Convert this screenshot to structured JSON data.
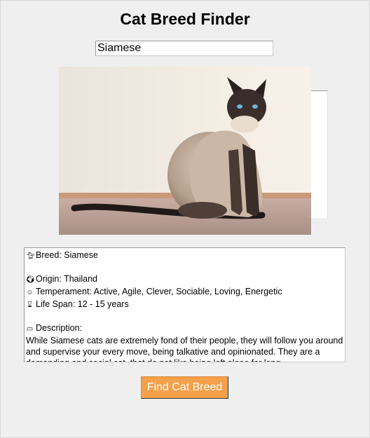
{
  "app": {
    "title": "Cat Breed Finder"
  },
  "search": {
    "value": "Siamese"
  },
  "info": {
    "breed_label": "Breed: Siamese",
    "origin_label": "Origin: Thailand",
    "temperament_label": "Temperament: Active, Agile, Clever, Sociable, Loving, Energetic",
    "lifespan_label": "Life Span: 12 - 15 years",
    "description_heading": "Description:",
    "description_text": "While Siamese cats are extremely fond of their people, they will follow you around and supervise your every move, being talkative and opinionated. They are a demanding and social cat, that do not like being left alone for long",
    "icons": [
      "cat-icon",
      "globe-icon",
      "smile-icon",
      "hourglass-icon",
      "scroll-icon"
    ]
  },
  "actions": {
    "find_label": "Find Cat Breed"
  },
  "colors": {
    "button_bg": "#f5a04a",
    "background": "#efefef"
  }
}
